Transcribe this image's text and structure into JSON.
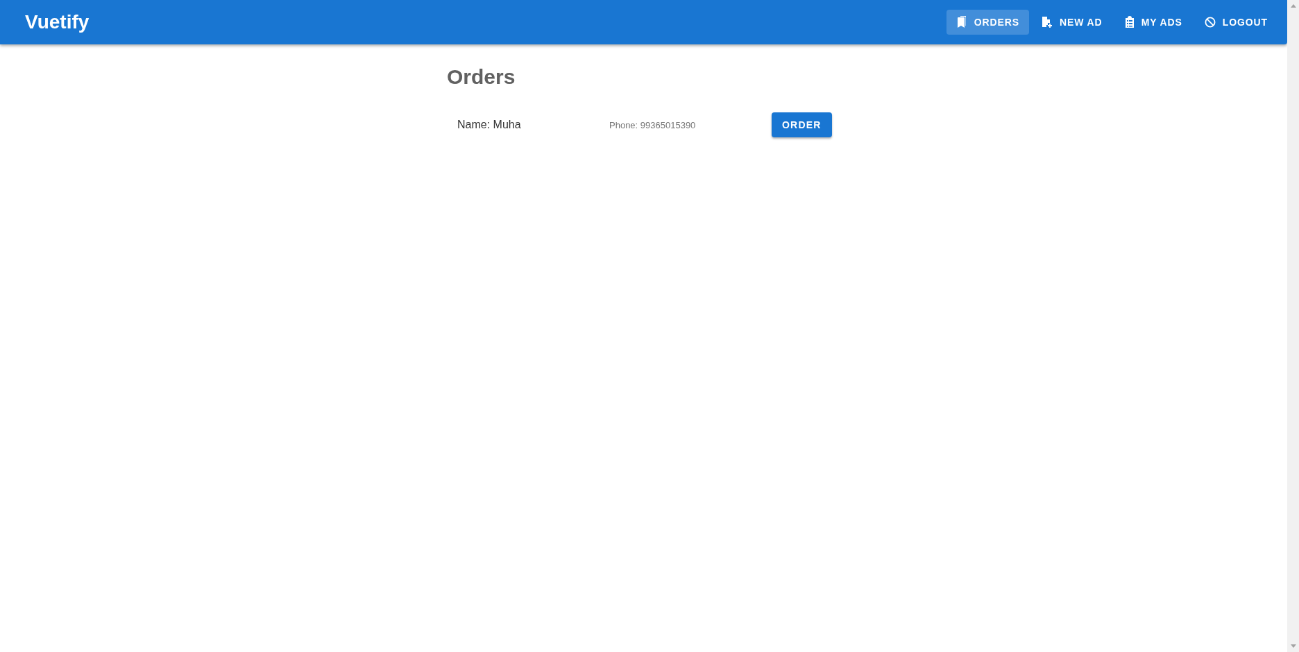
{
  "app_bar": {
    "title": "Vuetify",
    "nav": [
      {
        "label": "ORDERS",
        "kind": "orders",
        "selected": true
      },
      {
        "label": "NEW AD",
        "kind": "new-ad",
        "selected": false
      },
      {
        "label": "MY ADS",
        "kind": "my-ads",
        "selected": false
      },
      {
        "label": "LOGOUT",
        "kind": "logout",
        "selected": false
      }
    ]
  },
  "page": {
    "heading": "Orders",
    "orders": [
      {
        "name": "Name: Muha",
        "phone": "Phone: 99365015390",
        "button": "ORDER"
      }
    ]
  }
}
